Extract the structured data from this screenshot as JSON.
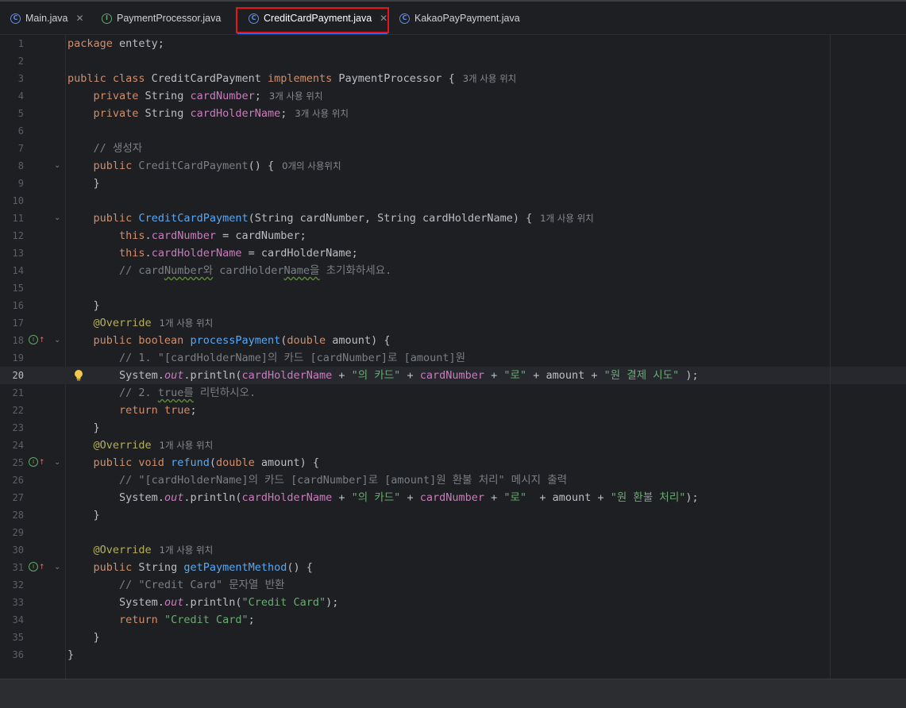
{
  "tabs": [
    {
      "name": "Main.java",
      "icon": "main-class-icon",
      "closable": true
    },
    {
      "name": "PaymentProcessor.java",
      "icon": "interface-icon",
      "closable": false
    },
    {
      "name": "CreditCardPayment.java",
      "icon": "class-icon",
      "closable": true,
      "active": true
    },
    {
      "name": "KakaoPayPayment.java",
      "icon": "class-icon",
      "closable": false
    }
  ],
  "current_line": 20,
  "code": {
    "l1_kw": "package",
    "l1_rest": " entety;",
    "l3_kw": "public class",
    "l3_name": " CreditCardPayment ",
    "l3_kw2": "implements",
    "l3_rest": " PaymentProcessor {",
    "l3_hint": "3개 사용 위치",
    "l4_kw": "private",
    "l4_type": " String ",
    "l4_field": "cardNumber",
    "l4_rest": ";",
    "l4_hint": "3개 사용 위치",
    "l5_kw": "private",
    "l5_type": " String ",
    "l5_field": "cardHolderName",
    "l5_rest": ";",
    "l5_hint": "3개 사용 위치",
    "l7_cmt": "// 생성자",
    "l8_kw": "public",
    "l8_name": " CreditCardPayment",
    "l8_rest": "() {",
    "l8_hint": "0개의 사용위치",
    "l9": "}",
    "l11_kw": "public",
    "l11_name": "CreditCardPayment",
    "l11_rest": "(String cardNumber, String cardHolderName) {",
    "l11_hint": "1개 사용 위치",
    "l12_kw": "this",
    "l12_dot": ".",
    "l12_field": "cardNumber",
    "l12_rest": " = cardNumber;",
    "l13_kw": "this",
    "l13_dot": ".",
    "l13_field": "cardHolderName",
    "l13_rest": " = cardHolderName;",
    "l14_a": "// card",
    "l14_b": "Number와",
    "l14_c": " cardHolder",
    "l14_d": "Name을",
    "l14_e": " 초기화하세요.",
    "l16": "}",
    "l17_ann": "@Override",
    "l17_hint": "1개 사용 위치",
    "l18_kw": "public boolean",
    "l18_name": "processPayment",
    "l18_p": "(",
    "l18_kw2": "double",
    "l18_rest": " amount) {",
    "l19_cmt": "// 1. \"[cardHolderName]의 카드 [cardNumber]로 [amount]원",
    "l20_a": "System.",
    "l20_out": "out",
    "l20_b": ".println(",
    "l20_f1": "cardHolderName",
    "l20_c": " + ",
    "l20_s1": "\"의 카드\"",
    "l20_d": " + ",
    "l20_f2": "cardNumber",
    "l20_e": " + ",
    "l20_s2": "\"로\"",
    "l20_f": " + amount + ",
    "l20_s3": "\"원 결제 시도\"",
    "l20_g": " );",
    "l21_a": "// 2. ",
    "l21_b": "true를",
    "l21_c": " 리턴하시오.",
    "l22_kw": "return",
    "l22_kw2": "true",
    "l22_rest": ";",
    "l23": "}",
    "l24_ann": "@Override",
    "l24_hint": "1개 사용 위치",
    "l25_kw": "public void",
    "l25_name": "refund",
    "l25_p": "(",
    "l25_kw2": "double",
    "l25_rest": " amount) {",
    "l26_cmt": "// \"[cardHolderName]의 카드 [cardNumber]로 [amount]원 환불 처리\" 메시지 출력",
    "l27_a": "System.",
    "l27_out": "out",
    "l27_b": ".println(",
    "l27_f1": "cardHolderName",
    "l27_c": " + ",
    "l27_s1": "\"의 카드\"",
    "l27_d": " + ",
    "l27_f2": "cardNumber",
    "l27_e": " + ",
    "l27_s2": "\"로\"",
    "l27_f": "  + amount + ",
    "l27_s3": "\"원 환불 처리\"",
    "l27_g": ");",
    "l28": "}",
    "l30_ann": "@Override",
    "l30_hint": "1개 사용 위치",
    "l31_kw": "public",
    "l31_type": " String ",
    "l31_name": "getPaymentMethod",
    "l31_rest": "() {",
    "l32_cmt": "// \"Credit Card\" 문자열 반환",
    "l33_a": "System.",
    "l33_out": "out",
    "l33_b": ".println(",
    "l33_s": "\"Credit Card\"",
    "l33_c": ");",
    "l34_kw": "return",
    "l34_s": " \"Credit Card\"",
    "l34_rest": ";",
    "l35": "}",
    "l36": "}"
  }
}
